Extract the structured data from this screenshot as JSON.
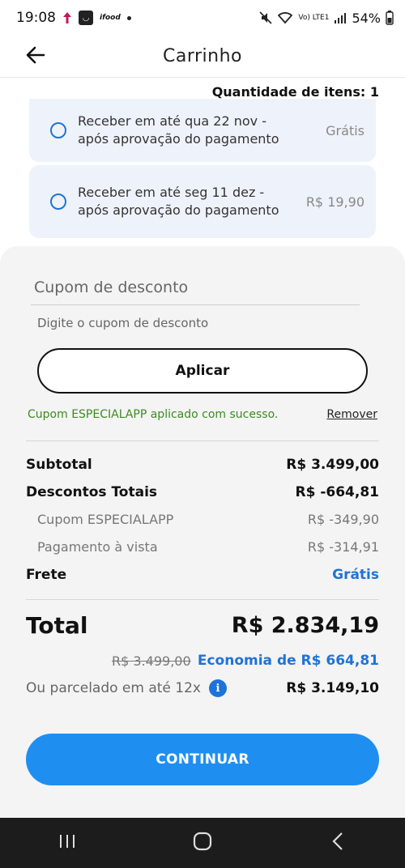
{
  "status_bar": {
    "time": "19:08",
    "ifood_label": "ifood",
    "network_label": "Vo) LTE1",
    "battery": "54%"
  },
  "app_bar": {
    "title": "Carrinho",
    "back_icon": "arrow-left-icon"
  },
  "cart": {
    "quantity_label": "Quantidade de itens: 1"
  },
  "shipping_options": [
    {
      "label": "Receber em até qua 22 nov - após aprovação do pagamento",
      "price": "Grátis"
    },
    {
      "label": "Receber em até seg 11 dez - após aprovação do pagamento",
      "price": "R$ 19,90"
    }
  ],
  "coupon": {
    "title": "Cupom de desconto",
    "placeholder": "Digite o cupom de desconto",
    "value": "",
    "apply_label": "Aplicar",
    "success_message": "Cupom ESPECIALAPP aplicado com sucesso.",
    "remove_label": "Remover"
  },
  "summary": {
    "subtotal_label": "Subtotal",
    "subtotal_value": "R$ 3.499,00",
    "discounts_label": "Descontos Totais",
    "discounts_value": "R$ -664,81",
    "coupon_discount_label": "Cupom ESPECIALAPP",
    "coupon_discount_value": "R$ -349,90",
    "cash_discount_label": "Pagamento à vista",
    "cash_discount_value": "R$ -314,91",
    "shipping_label": "Frete",
    "shipping_value": "Grátis",
    "total_label": "Total",
    "total_value": "R$ 2.834,19",
    "old_price": "R$ 3.499,00",
    "economy_label": "Economia de R$ 664,81",
    "installment_label": "Ou parcelado em até 12x",
    "installment_value": "R$ 3.149,10"
  },
  "actions": {
    "continue_label": "CONTINUAR"
  },
  "colors": {
    "accent_blue": "#1e73d8",
    "button_blue": "#1e8ff0",
    "success_green": "#3d8a22",
    "card_background": "#eef3fb"
  }
}
